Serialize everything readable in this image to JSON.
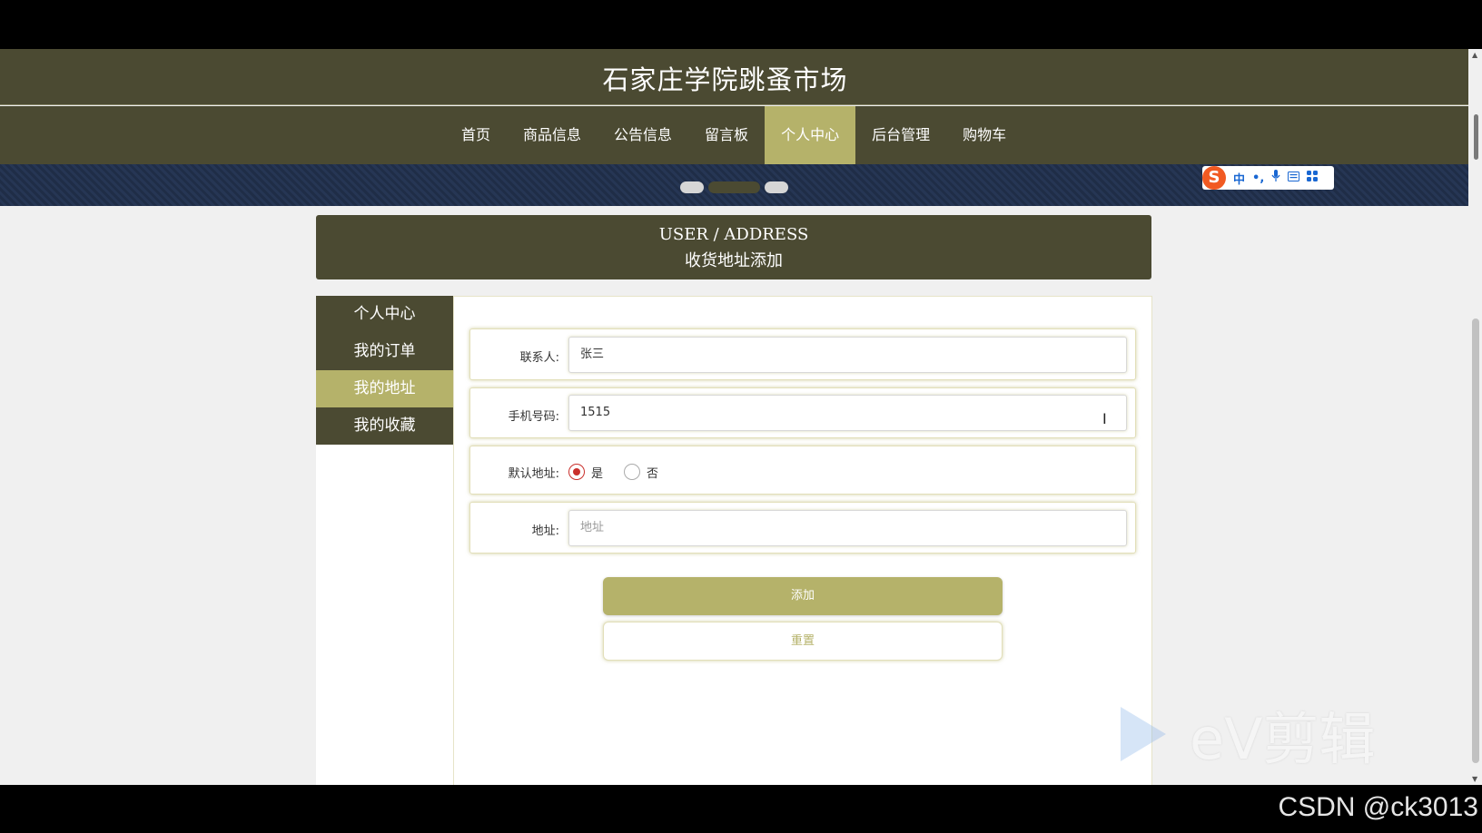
{
  "site": {
    "title": "石家庄学院跳蚤市场"
  },
  "nav": {
    "items": [
      {
        "label": "首页"
      },
      {
        "label": "商品信息"
      },
      {
        "label": "公告信息"
      },
      {
        "label": "留言板"
      },
      {
        "label": "个人中心",
        "active": true
      },
      {
        "label": "后台管理"
      },
      {
        "label": "购物车"
      }
    ]
  },
  "banner": {
    "active_slide": 2,
    "slides": 3
  },
  "ime_toolbar": {
    "logo": "S",
    "items": [
      "中",
      "•,",
      "mic-icon",
      "keyboard-icon",
      "grid-icon"
    ]
  },
  "page_head": {
    "en": "USER / ADDRESS",
    "cn": "收货地址添加"
  },
  "sidebar": {
    "items": [
      {
        "label": "个人中心"
      },
      {
        "label": "我的订单"
      },
      {
        "label": "我的地址",
        "active": true
      },
      {
        "label": "我的收藏"
      }
    ]
  },
  "form": {
    "contact": {
      "label": "联系人:",
      "value": "张三"
    },
    "phone": {
      "label": "手机号码:",
      "value": "1515"
    },
    "default_address": {
      "label": "默认地址:",
      "yes": "是",
      "no": "否",
      "selected": "是"
    },
    "address": {
      "label": "地址:",
      "placeholder": "地址"
    },
    "add_button": "添加",
    "reset_button": "重置"
  },
  "colors": {
    "primary": "#4b4a32",
    "accent": "#b5b26a",
    "radio": "#c9302c"
  },
  "watermark": {
    "text": "eV剪辑"
  },
  "credit": {
    "text": "CSDN @ck3013"
  }
}
